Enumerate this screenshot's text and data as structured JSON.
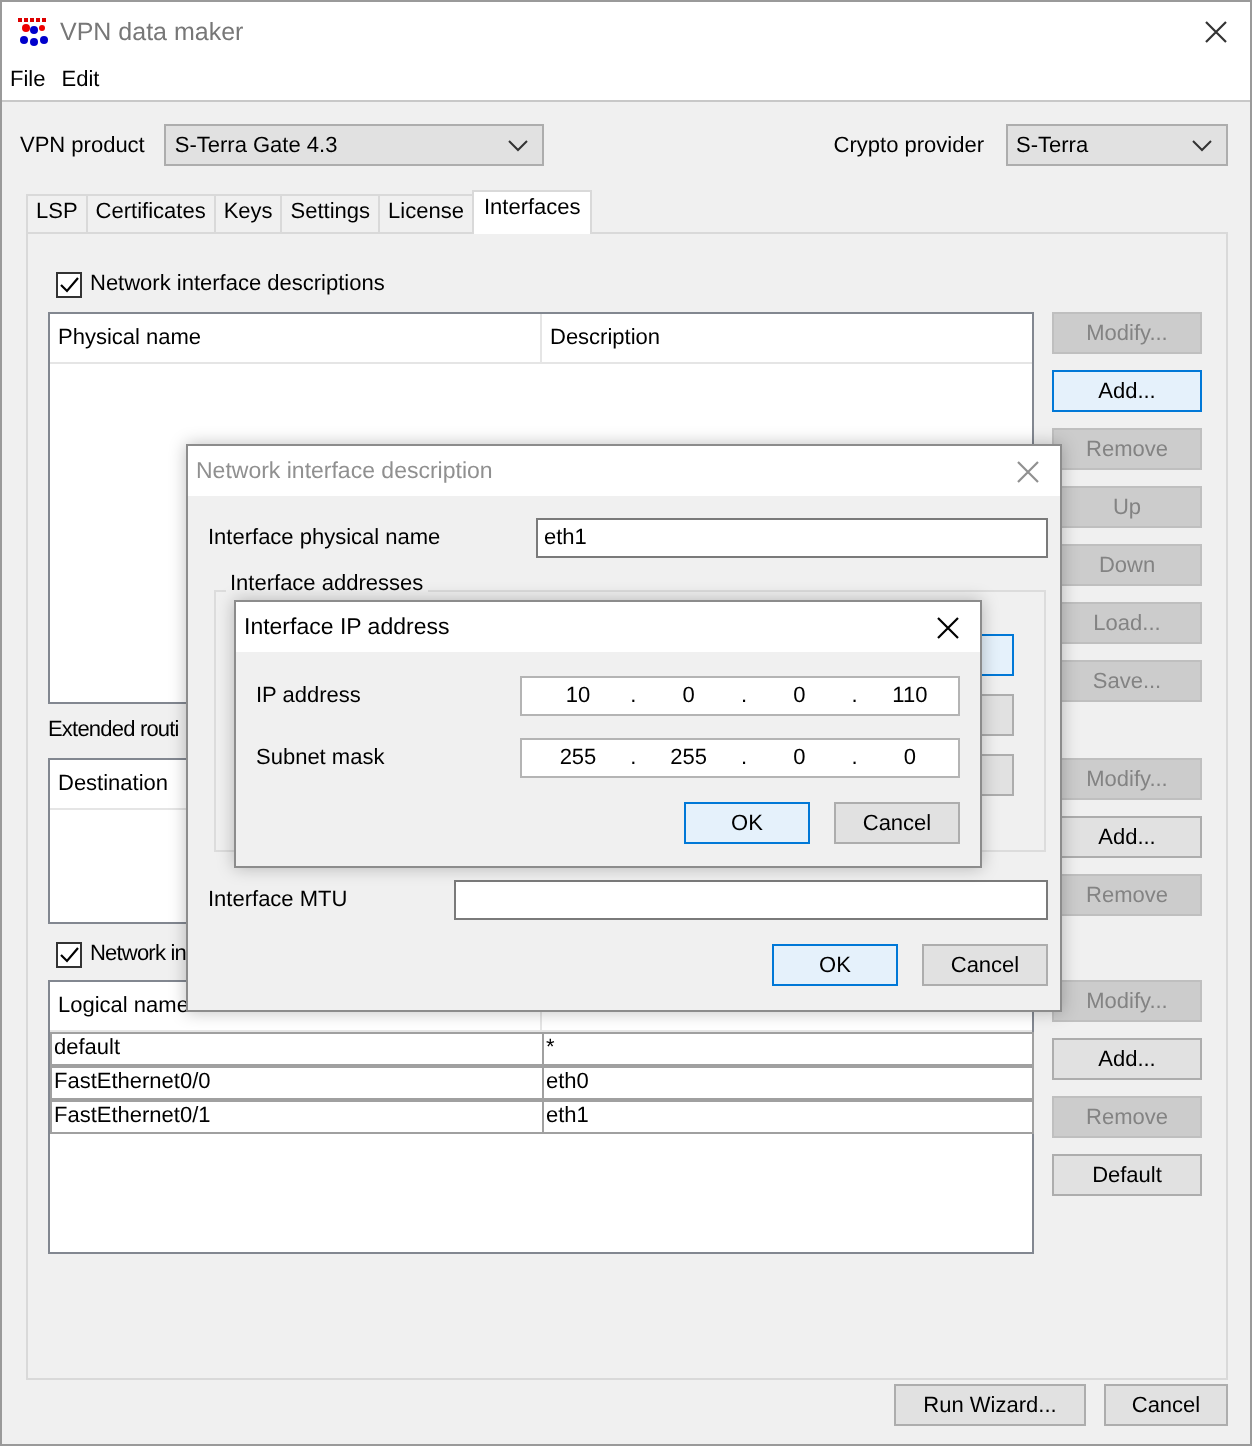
{
  "window": {
    "title": "VPN data maker"
  },
  "menu": [
    {
      "label": "File"
    },
    {
      "label": "Edit"
    }
  ],
  "vpn_product": {
    "label": "VPN product",
    "value": "S-Terra Gate 4.3"
  },
  "crypto_provider": {
    "label": "Crypto provider",
    "value": "S-Terra"
  },
  "tabs": [
    {
      "label": "LSP",
      "selected": false
    },
    {
      "label": "Certificates",
      "selected": false
    },
    {
      "label": "Keys",
      "selected": false
    },
    {
      "label": "Settings",
      "selected": false
    },
    {
      "label": "License",
      "selected": false
    },
    {
      "label": "Interfaces",
      "selected": true
    }
  ],
  "descriptions": {
    "checkbox": {
      "label": "Network interface descriptions",
      "checked": true
    },
    "columns": [
      "Physical name",
      "Description"
    ],
    "buttons": [
      {
        "label": "Modify...",
        "disabled": true,
        "focused": false
      },
      {
        "label": "Add...",
        "disabled": false,
        "focused": true
      },
      {
        "label": "Remove",
        "disabled": true,
        "focused": false
      },
      {
        "label": "Up",
        "disabled": true,
        "focused": false
      },
      {
        "label": "Down",
        "disabled": true,
        "focused": false
      },
      {
        "label": "Load...",
        "disabled": true,
        "focused": false
      },
      {
        "label": "Save...",
        "disabled": true,
        "focused": false
      }
    ]
  },
  "routes": {
    "label": "Extended routi",
    "columns": [
      "Destination"
    ],
    "buttons": [
      {
        "label": "Modify...",
        "disabled": true,
        "focused": false
      },
      {
        "label": "Add...",
        "disabled": false,
        "focused": false
      },
      {
        "label": "Remove",
        "disabled": true,
        "focused": false
      }
    ]
  },
  "mapping": {
    "checkbox": {
      "label": "Network in",
      "checked": true
    },
    "columns": [
      "Logical name"
    ],
    "rows": [
      [
        "default",
        "*"
      ],
      [
        "FastEthernet0/0",
        "eth0"
      ],
      [
        "FastEthernet0/1",
        "eth1"
      ]
    ],
    "buttons": [
      {
        "label": "Modify...",
        "disabled": true,
        "focused": false
      },
      {
        "label": "Add...",
        "disabled": false,
        "focused": false
      },
      {
        "label": "Remove",
        "disabled": true,
        "focused": false
      },
      {
        "label": "Default",
        "disabled": false,
        "focused": false
      }
    ]
  },
  "footer_buttons": [
    {
      "label": "Run Wizard...",
      "disabled": false,
      "focused": false
    },
    {
      "label": "Cancel",
      "disabled": false,
      "focused": false
    }
  ],
  "interface_dialog": {
    "title": "Network interface description",
    "active": false,
    "physical_name": {
      "label": "Interface physical name",
      "value": "eth1"
    },
    "addresses_group": {
      "label": "Interface addresses"
    },
    "mtu": {
      "label": "Interface MTU"
    },
    "buttons": [
      {
        "label": "OK",
        "disabled": false,
        "focused": true
      },
      {
        "label": "Cancel",
        "disabled": false,
        "focused": false
      }
    ]
  },
  "ip_dialog": {
    "title": "Interface IP address",
    "active": true,
    "fields": [
      {
        "label": "IP address",
        "octets": [
          "10",
          "0",
          "0",
          "110"
        ],
        "separator": "."
      },
      {
        "label": "Subnet mask",
        "octets": [
          "255",
          "255",
          "0",
          "0"
        ],
        "separator": "."
      }
    ],
    "buttons": [
      {
        "label": "OK",
        "disabled": false,
        "focused": true
      },
      {
        "label": "Cancel",
        "disabled": false,
        "focused": false
      }
    ]
  }
}
